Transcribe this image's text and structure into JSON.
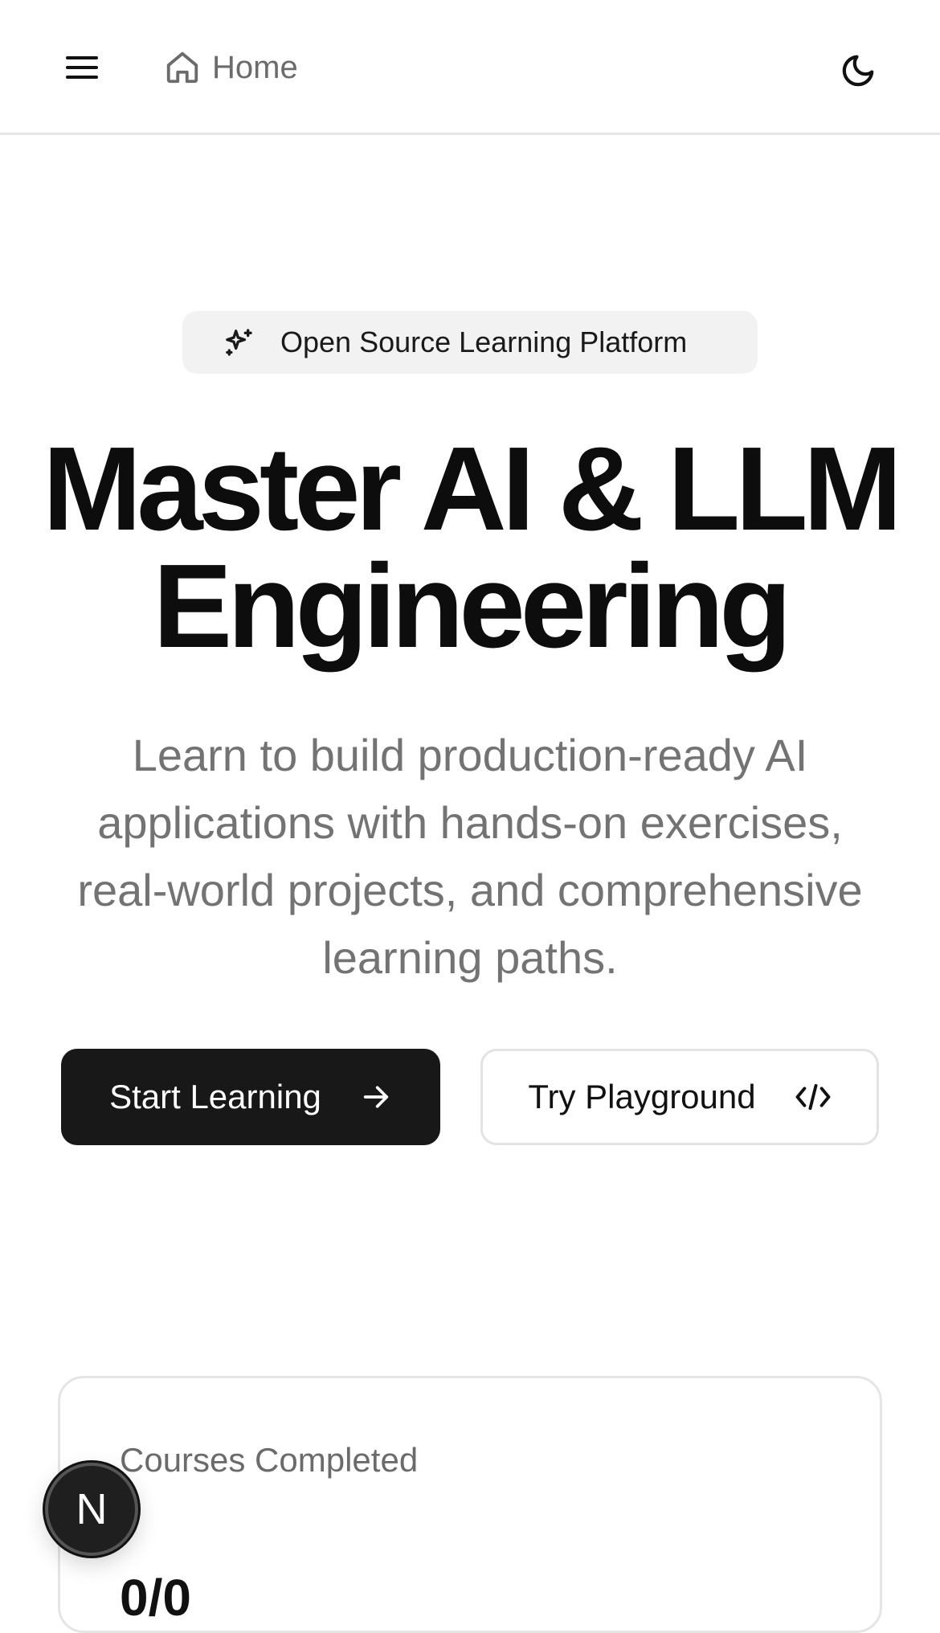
{
  "header": {
    "menu_icon": "hamburger-menu-icon",
    "home_icon": "house-icon",
    "home_label": "Home",
    "theme_icon": "moon-icon"
  },
  "hero": {
    "badge_icon": "sparkles-icon",
    "badge_text": "Open Source Learning Platform",
    "title_line1": "Master AI & LLM",
    "title_line2": "Engineering",
    "subtitle": "Learn to build production-ready AI applications with hands-on exercises, real-world projects, and comprehensive learning paths."
  },
  "actions": {
    "primary_label": "Start Learning",
    "primary_icon": "arrow-right-icon",
    "secondary_label": "Try Playground",
    "secondary_icon": "code-icon"
  },
  "stats": {
    "courses_label": "Courses Completed",
    "courses_value": "0/0"
  },
  "floating_badge": {
    "letter": "N"
  },
  "colors": {
    "primary_button_bg": "#181818",
    "muted_text": "#737373",
    "badge_bg": "#f2f2f2"
  }
}
